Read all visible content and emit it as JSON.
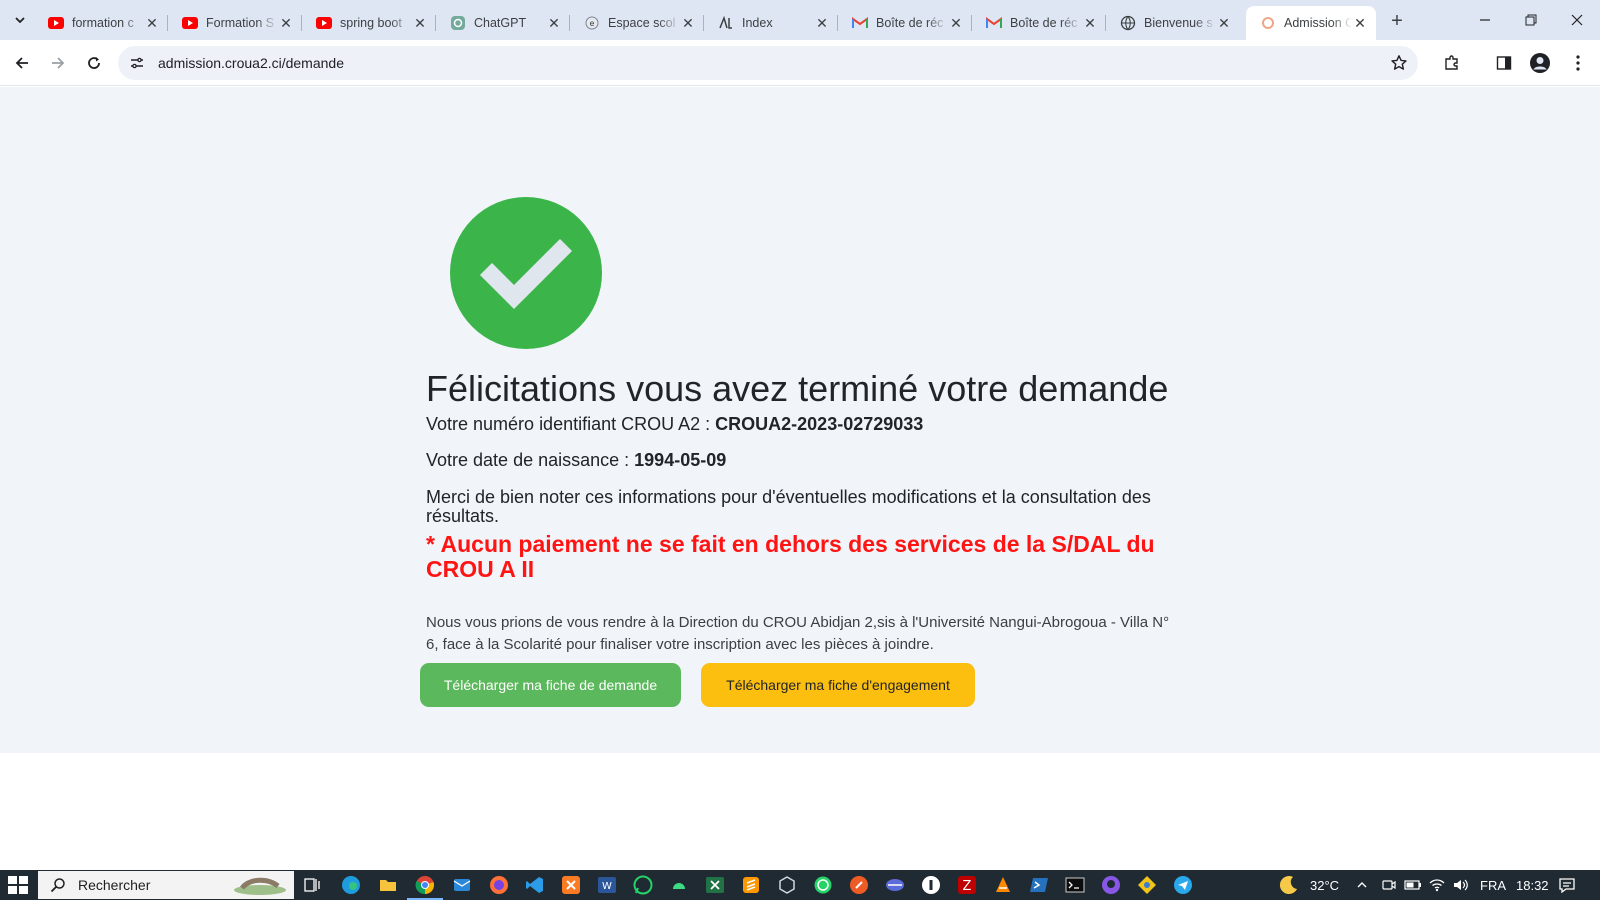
{
  "browser": {
    "tabs": [
      {
        "title": "formation c",
        "favicon": "youtube-icon",
        "active": false
      },
      {
        "title": "Formation S",
        "favicon": "youtube-icon",
        "active": false
      },
      {
        "title": "spring boot",
        "favicon": "youtube-icon",
        "active": false
      },
      {
        "title": "ChatGPT",
        "favicon": "chatgpt-icon",
        "active": false
      },
      {
        "title": "Espace scol",
        "favicon": "school-icon",
        "active": false
      },
      {
        "title": "Index",
        "favicon": "index-icon",
        "active": false
      },
      {
        "title": "Boîte de réc",
        "favicon": "gmail-icon",
        "active": false
      },
      {
        "title": "Boîte de réc",
        "favicon": "gmail-icon",
        "active": false
      },
      {
        "title": "Bienvenue s",
        "favicon": "globe-icon",
        "active": false
      },
      {
        "title": "Admission C",
        "favicon": "loading-icon",
        "active": true
      }
    ],
    "url": "admission.croua2.ci/demande"
  },
  "page": {
    "title": "Félicitations vous avez terminé votre demande",
    "id_label": "Votre numéro identifiant CROU A2 : ",
    "id_value": "CROUA2-2023-02729033",
    "dob_label": "Votre date de naissance : ",
    "dob_value": "1994-05-09",
    "note": "Merci de bien noter ces informations pour d'éventuelles modifications et la consultation des résultats.",
    "warning": "* Aucun paiement ne se fait en dehors des services de la S/DAL du CROU A II",
    "info": "Nous vous prions de vous rendre à la Direction du CROU Abidjan 2,sis à l'Université Nangui-Abrogoua - Villa N° 6, face à la Scolarité pour finaliser votre inscription avec les pièces à joindre.",
    "btn_demande": "Télécharger ma fiche de demande",
    "btn_engagement": "Télécharger ma fiche d'engagement"
  },
  "colors": {
    "success": "#3bb54a",
    "warning_text": "#ff1414",
    "btn_green": "#5cb85c",
    "btn_yellow": "#fcbe0f"
  },
  "taskbar": {
    "search_label": "Rechercher",
    "temperature": "32°C",
    "language": "FRA",
    "time": "18:32"
  }
}
